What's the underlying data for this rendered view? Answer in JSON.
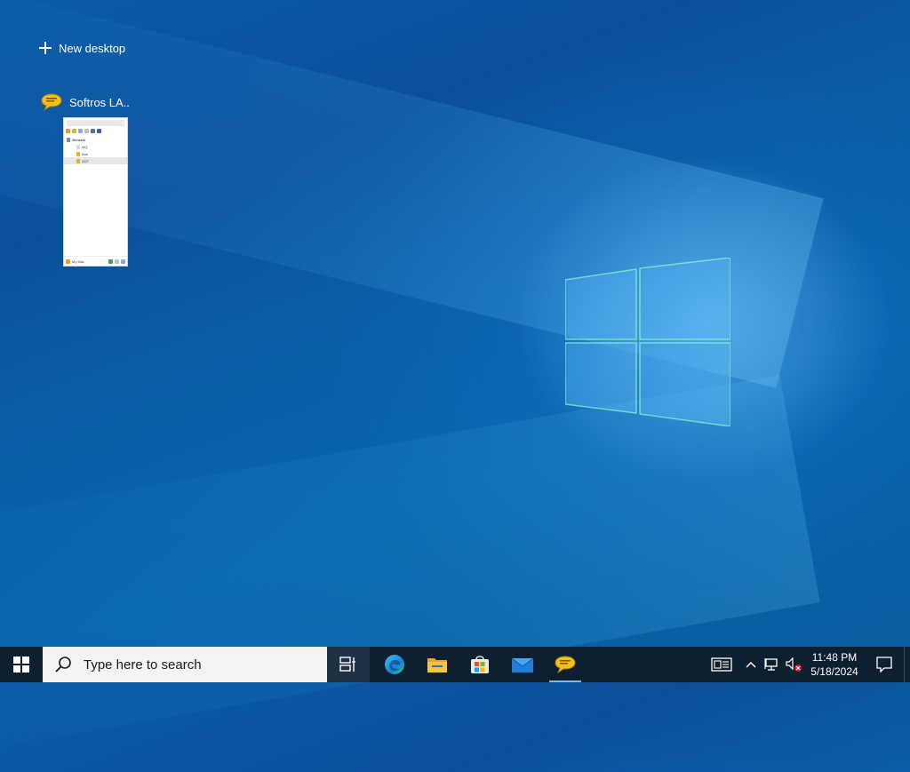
{
  "desktop": {
    "new_desktop_label": "New desktop"
  },
  "window": {
    "title": "Softros LA..",
    "icon": "speech-bubble-icon",
    "preview": {
      "group": "General",
      "users": [
        "MQ",
        "Bob",
        "ADT"
      ],
      "status_user": "My Mac"
    }
  },
  "taskbar": {
    "search_placeholder": "Type here to search",
    "apps": [
      {
        "name": "task-view",
        "icon": "task-view-icon"
      },
      {
        "name": "edge",
        "icon": "edge-icon"
      },
      {
        "name": "file-explorer",
        "icon": "folder-icon"
      },
      {
        "name": "store",
        "icon": "store-icon"
      },
      {
        "name": "mail",
        "icon": "mail-icon"
      },
      {
        "name": "softros",
        "icon": "speech-bubble-icon"
      }
    ],
    "clock": {
      "time": "11:48 PM",
      "date": "5/18/2024"
    }
  },
  "colors": {
    "taskbar_bg": "#0e1f30",
    "accent": "#7ab7f0",
    "desktop_blue": "#0a5aa8"
  }
}
